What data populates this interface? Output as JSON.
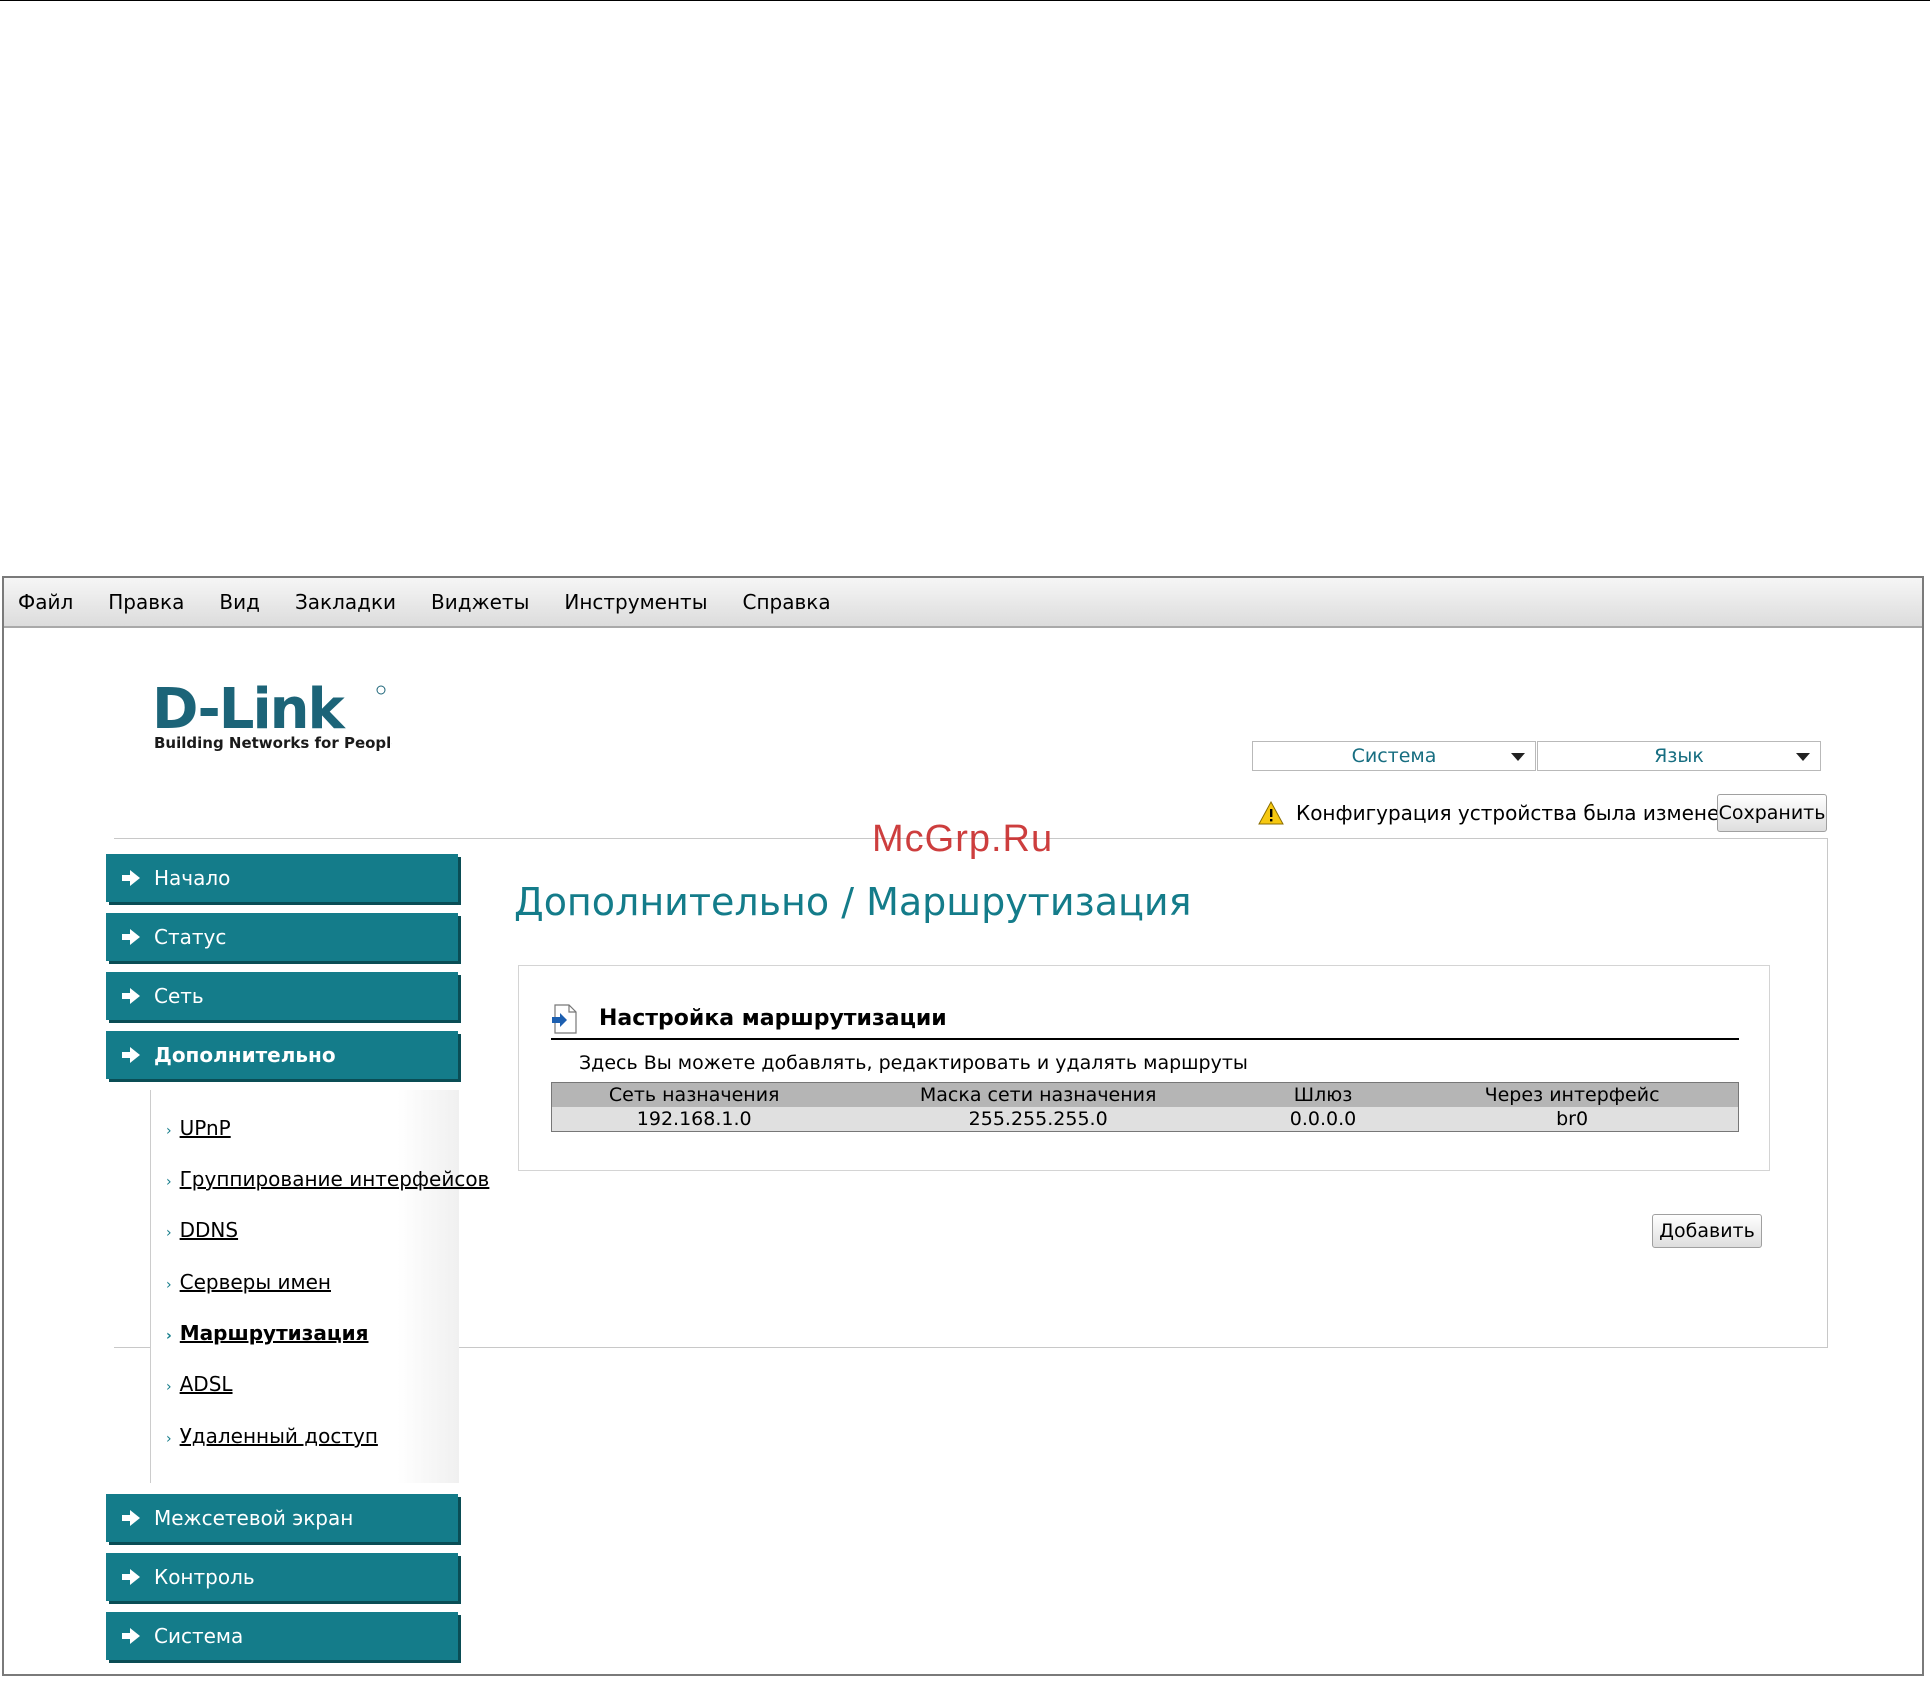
{
  "menubar": {
    "items": [
      "Файл",
      "Правка",
      "Вид",
      "Закладки",
      "Виджеты",
      "Инструменты",
      "Справка"
    ]
  },
  "logo": {
    "brand": "D-Link",
    "tagline": "Building Networks for People"
  },
  "header": {
    "system_select": "Система",
    "language_select": "Язык",
    "notice": "Конфигурация устройства была изменена",
    "save_label": "Сохранить"
  },
  "watermark": "McGrp.Ru",
  "sidebar": {
    "top_items": [
      {
        "label": "Начало"
      },
      {
        "label": "Статус"
      },
      {
        "label": "Сеть"
      },
      {
        "label": "Дополнительно"
      }
    ],
    "sub_items": [
      {
        "label": "UPnP"
      },
      {
        "label": "Группирование интерфейсов"
      },
      {
        "label": "DDNS"
      },
      {
        "label": "Серверы имен"
      },
      {
        "label": "Маршрутизация"
      },
      {
        "label": "ADSL"
      },
      {
        "label": "Удаленный доступ"
      }
    ],
    "bottom_items": [
      {
        "label": "Межсетевой экран"
      },
      {
        "label": "Контроль"
      },
      {
        "label": "Система"
      }
    ]
  },
  "main": {
    "page_title": "Дополнительно /  Маршрутизация",
    "panel_title": "Настройка маршрутизации",
    "panel_desc": "Здесь Вы можете добавлять, редактировать и удалять маршруты",
    "table": {
      "headers": [
        "Сеть назначения",
        "Маска сети назначения",
        "Шлюз",
        "Через интерфейс"
      ],
      "rows": [
        [
          "192.168.1.0",
          "255.255.255.0",
          "0.0.0.0",
          "br0"
        ]
      ]
    },
    "add_label": "Добавить"
  },
  "colors": {
    "accent": "#147c8a",
    "nav_bg": "#147c8a",
    "title": "#147c8a",
    "watermark": "#c82a2a"
  }
}
